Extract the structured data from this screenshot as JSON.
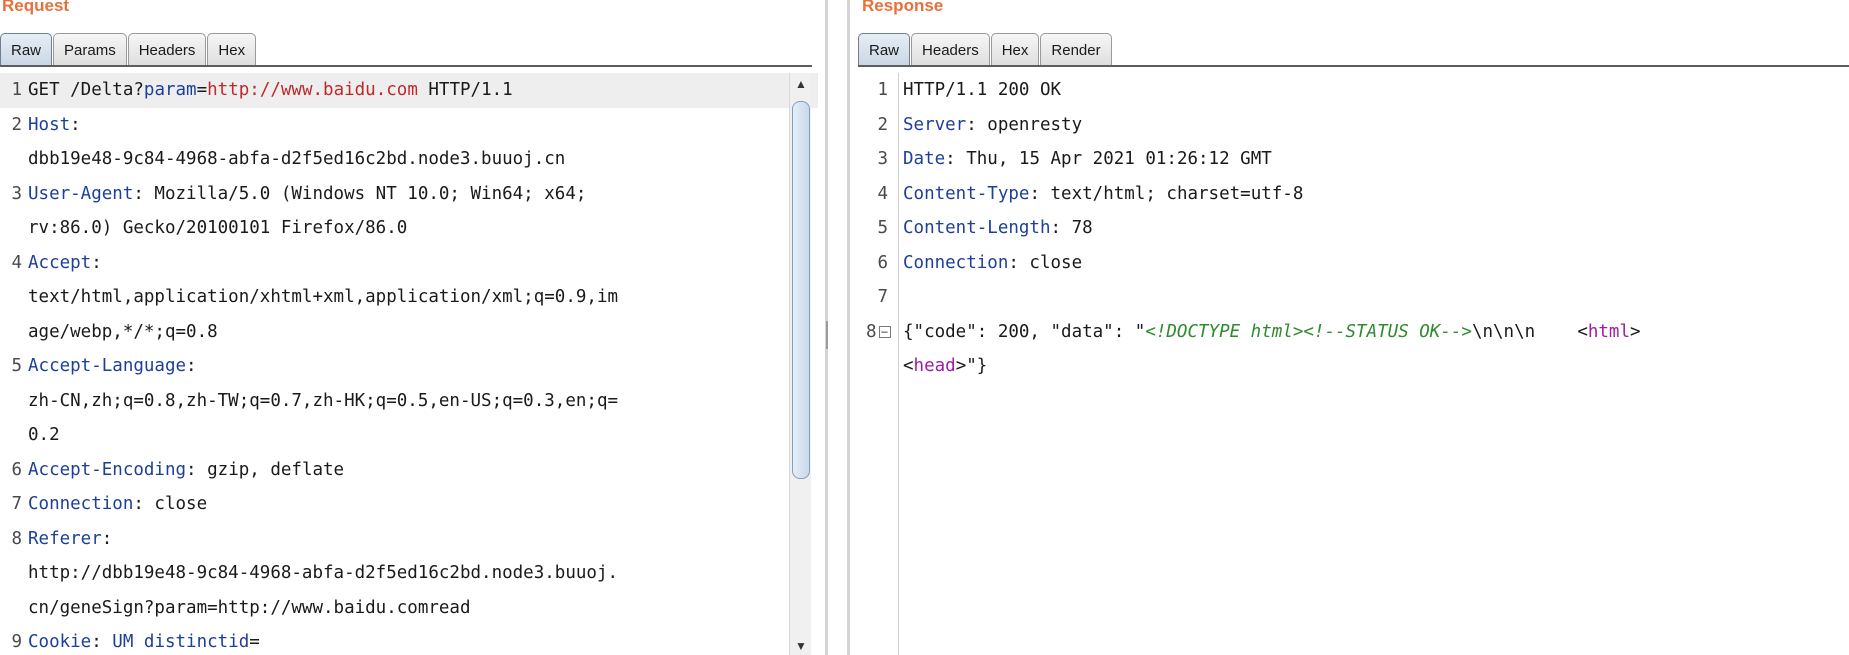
{
  "request": {
    "title": "Request",
    "tabs": [
      "Raw",
      "Params",
      "Headers",
      "Hex"
    ],
    "lines": [
      {
        "no": "1",
        "parts": [
          {
            "t": "GET /Delta?",
            "c": ""
          },
          {
            "t": "param",
            "c": "k"
          },
          {
            "t": "=",
            "c": ""
          },
          {
            "t": "http://www.baidu.com",
            "c": "r"
          },
          {
            "t": " HTTP/1.1",
            "c": ""
          }
        ]
      },
      {
        "no": "2",
        "parts": [
          {
            "t": "Host",
            "c": "k"
          },
          {
            "t": ":",
            "c": ""
          }
        ]
      },
      {
        "no": "",
        "parts": [
          {
            "t": "dbb19e48-9c84-4968-abfa-d2f5ed16c2bd.node3.buuoj.cn",
            "c": ""
          }
        ]
      },
      {
        "no": "3",
        "parts": [
          {
            "t": "User-Agent",
            "c": "k"
          },
          {
            "t": ": Mozilla/5.0 (Windows NT 10.0; Win64; x64;",
            "c": ""
          }
        ]
      },
      {
        "no": "",
        "parts": [
          {
            "t": "rv:86.0) Gecko/20100101 Firefox/86.0",
            "c": ""
          }
        ]
      },
      {
        "no": "4",
        "parts": [
          {
            "t": "Accept",
            "c": "k"
          },
          {
            "t": ":",
            "c": ""
          }
        ]
      },
      {
        "no": "",
        "parts": [
          {
            "t": "text/html,application/xhtml+xml,application/xml;q=0.9,im",
            "c": ""
          }
        ]
      },
      {
        "no": "",
        "parts": [
          {
            "t": "age/webp,*/*;q=0.8",
            "c": ""
          }
        ]
      },
      {
        "no": "5",
        "parts": [
          {
            "t": "Accept-Language",
            "c": "k"
          },
          {
            "t": ":",
            "c": ""
          }
        ]
      },
      {
        "no": "",
        "parts": [
          {
            "t": "zh-CN,zh;q=0.8,zh-TW;q=0.7,zh-HK;q=0.5,en-US;q=0.3,en;q=",
            "c": ""
          }
        ]
      },
      {
        "no": "",
        "parts": [
          {
            "t": "0.2",
            "c": ""
          }
        ]
      },
      {
        "no": "6",
        "parts": [
          {
            "t": "Accept-Encoding",
            "c": "k"
          },
          {
            "t": ": gzip, deflate",
            "c": ""
          }
        ]
      },
      {
        "no": "7",
        "parts": [
          {
            "t": "Connection",
            "c": "k"
          },
          {
            "t": ": close",
            "c": ""
          }
        ]
      },
      {
        "no": "8",
        "parts": [
          {
            "t": "Referer",
            "c": "k"
          },
          {
            "t": ":",
            "c": ""
          }
        ]
      },
      {
        "no": "",
        "parts": [
          {
            "t": "http://dbb19e48-9c84-4968-abfa-d2f5ed16c2bd.node3.buuoj.",
            "c": ""
          }
        ]
      },
      {
        "no": "",
        "parts": [
          {
            "t": "cn/geneSign?param=http://www.baidu.comread",
            "c": ""
          }
        ]
      },
      {
        "no": "9",
        "parts": [
          {
            "t": "Cookie",
            "c": "k"
          },
          {
            "t": ": ",
            "c": ""
          },
          {
            "t": "UM distinctid",
            "c": "k"
          },
          {
            "t": "=",
            "c": ""
          }
        ]
      }
    ]
  },
  "response": {
    "title": "Response",
    "tabs": [
      "Raw",
      "Headers",
      "Hex",
      "Render"
    ],
    "lines": [
      {
        "no": "1",
        "parts": [
          {
            "t": "HTTP/1.1 200 OK",
            "c": ""
          }
        ]
      },
      {
        "no": "2",
        "parts": [
          {
            "t": "Server",
            "c": "k"
          },
          {
            "t": ": openresty",
            "c": ""
          }
        ]
      },
      {
        "no": "3",
        "parts": [
          {
            "t": "Date",
            "c": "k"
          },
          {
            "t": ": Thu, 15 Apr 2021 01:26:12 GMT",
            "c": ""
          }
        ]
      },
      {
        "no": "4",
        "parts": [
          {
            "t": "Content-Type",
            "c": "k"
          },
          {
            "t": ": text/html; charset=utf-8",
            "c": ""
          }
        ]
      },
      {
        "no": "5",
        "parts": [
          {
            "t": "Content-Length",
            "c": "k"
          },
          {
            "t": ": 78",
            "c": ""
          }
        ]
      },
      {
        "no": "6",
        "parts": [
          {
            "t": "Connection",
            "c": "k"
          },
          {
            "t": ": close",
            "c": ""
          }
        ]
      },
      {
        "no": "7",
        "parts": []
      },
      {
        "no": "8",
        "fold": true,
        "parts": [
          {
            "t": "{\"code\": 200, \"data\": \"",
            "c": ""
          },
          {
            "t": "<!DOCTYPE html><!--STATUS OK-->",
            "c": "g"
          },
          {
            "t": "\\n\\n\\n    ",
            "c": ""
          },
          {
            "t": "<",
            "c": ""
          },
          {
            "t": "html",
            "c": "m"
          },
          {
            "t": ">",
            "c": ""
          }
        ]
      },
      {
        "no": "",
        "parts": [
          {
            "t": "<",
            "c": ""
          },
          {
            "t": "head",
            "c": "m"
          },
          {
            "t": ">\"}",
            "c": ""
          }
        ]
      }
    ]
  },
  "colors": {
    "title": "#e8703a",
    "keyword": "#1d3f9a",
    "url": "#c0282a",
    "comment": "#2f8a2f",
    "tag": "#a21ca2"
  },
  "icons": {
    "scroll_up": "scroll-up-arrow-icon",
    "scroll_down": "scroll-down-arrow-icon",
    "fold": "fold-toggle-icon"
  }
}
